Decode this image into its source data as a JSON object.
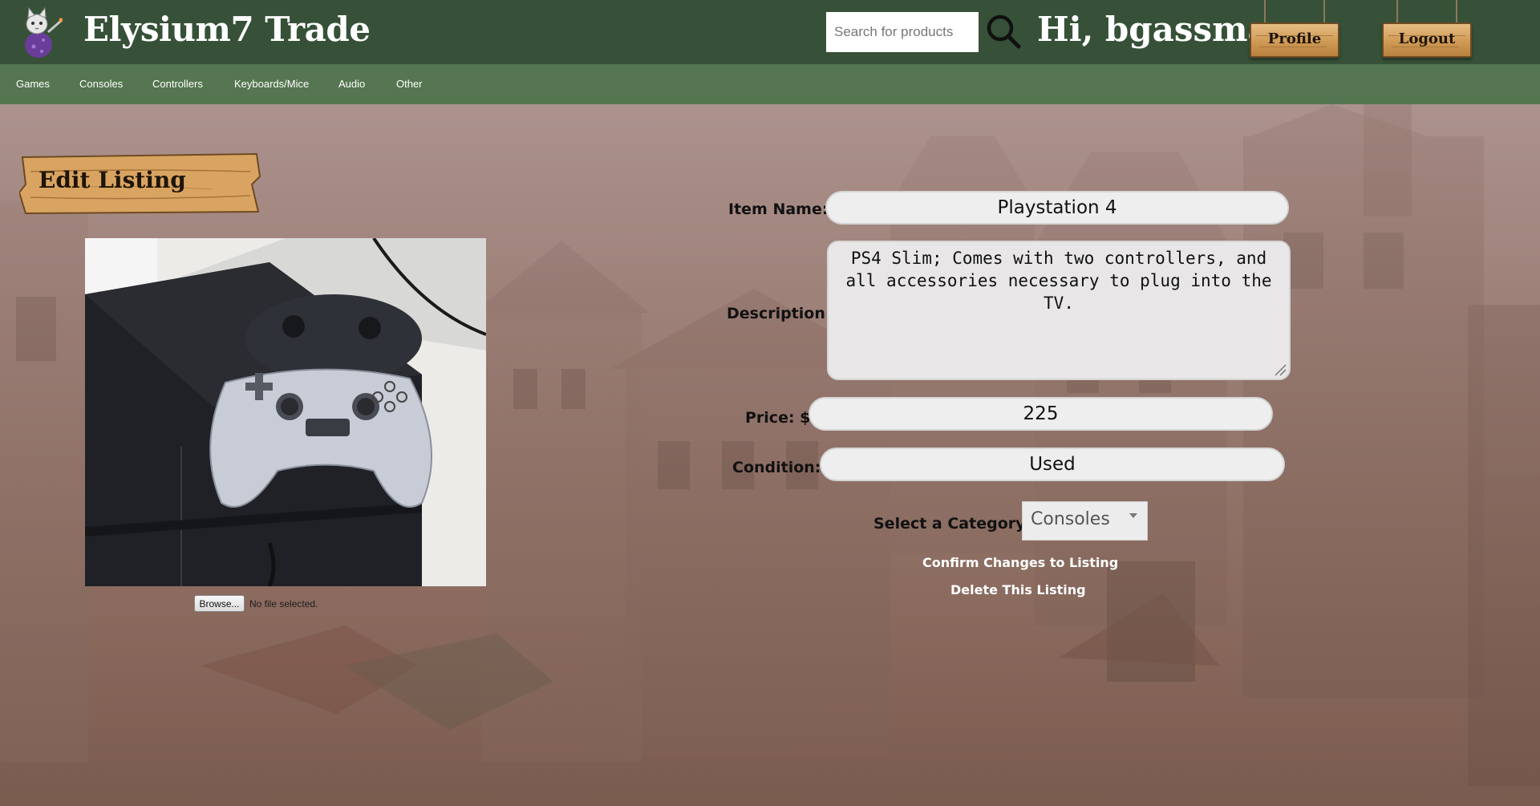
{
  "header": {
    "site_title": "Elysium7 Trade",
    "search_placeholder": "Search for products",
    "greeting": "Hi, bgassman",
    "profile_label": "Profile",
    "logout_label": "Logout"
  },
  "nav": {
    "items": [
      "Games",
      "Consoles",
      "Controllers",
      "Keyboards/Mice",
      "Audio",
      "Other"
    ]
  },
  "page": {
    "heading": "Edit Listing"
  },
  "upload": {
    "browse_label": "Browse...",
    "status": "No file selected."
  },
  "form": {
    "item_name_label": "Item Name:",
    "item_name_value": "Playstation 4",
    "description_label": "Description:",
    "description_value": "PS4 Slim; Comes with two controllers, and all accessories necessary to plug into the TV.",
    "price_label": "Price: $",
    "price_value": "225",
    "condition_label": "Condition:",
    "condition_value": "Used",
    "category_label": "Select a Category:",
    "category_value": "Consoles",
    "confirm_label": "Confirm Changes to Listing",
    "delete_label": "Delete This Listing"
  },
  "colors": {
    "header_bg": "#365138",
    "nav_bg": "#557650",
    "sign_wood": "#d9a461"
  }
}
